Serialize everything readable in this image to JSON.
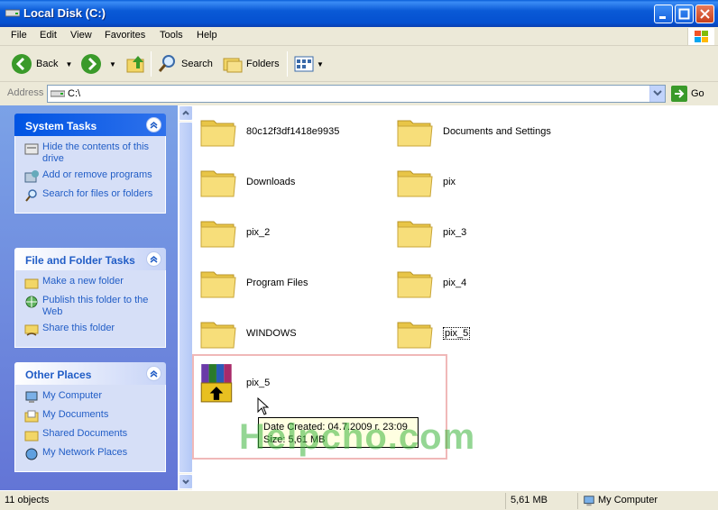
{
  "window": {
    "title": "Local Disk (C:)"
  },
  "menu": [
    "File",
    "Edit",
    "View",
    "Favorites",
    "Tools",
    "Help"
  ],
  "toolbar": {
    "back": "Back",
    "search": "Search",
    "folders": "Folders"
  },
  "address": {
    "label": "Address",
    "value": "C:\\",
    "go": "Go"
  },
  "panels": {
    "system_tasks": {
      "title": "System Tasks",
      "items": [
        "Hide the contents of this drive",
        "Add or remove programs",
        "Search for files or folders"
      ]
    },
    "file_tasks": {
      "title": "File and Folder Tasks",
      "items": [
        "Make a new folder",
        "Publish this folder to the Web",
        "Share this folder"
      ]
    },
    "other_places": {
      "title": "Other Places",
      "items": [
        "My Computer",
        "My Documents",
        "Shared Documents",
        "My Network Places"
      ]
    }
  },
  "files": [
    "80c12f3df1418e9935",
    "Documents and Settings",
    "Downloads",
    "pix",
    "pix_2",
    "pix_3",
    "Program Files",
    "pix_4",
    "WINDOWS",
    "pix_5",
    "pix_5"
  ],
  "tooltip": {
    "line1": "Date Created: 04.7.2009 г. 23:09",
    "line2": "Size: 5,61 MB"
  },
  "watermark": "Helpcho.com",
  "status": {
    "objects": "11 objects",
    "size": "5,61 MB",
    "location": "My Computer"
  }
}
